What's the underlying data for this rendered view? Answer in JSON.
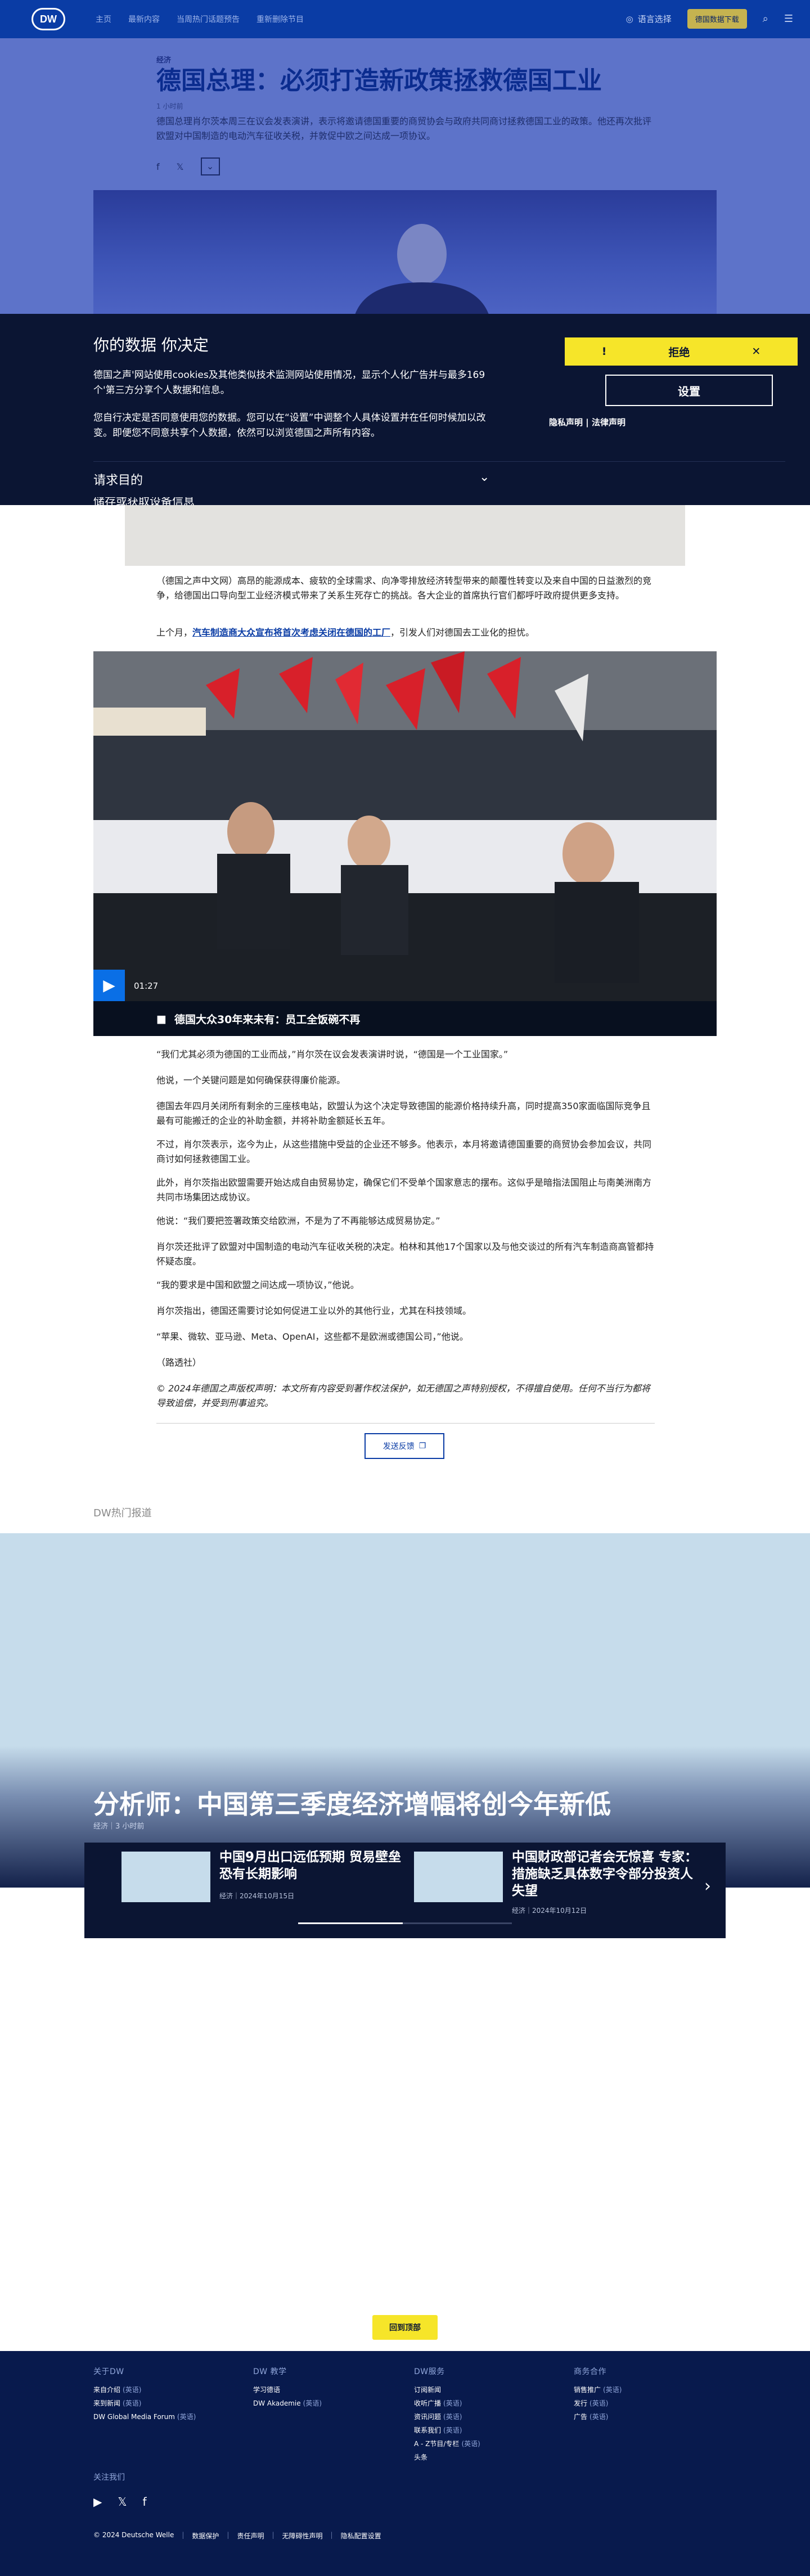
{
  "header": {
    "logo": "DW",
    "nav": [
      "主页",
      "最新内容",
      "当周热门话题预告",
      "重新删除节目"
    ],
    "lang_link": "语言选择",
    "app_button": "德国数据下载",
    "icon_search": "search-icon",
    "icon_menu": "menu-icon"
  },
  "article": {
    "kicker": "经济",
    "title": "德国总理：必须打造新政策拯救德国工业",
    "meta": "1 小时前",
    "teaser": "德国总理肖尔茨本周三在议会发表演讲，表示将邀请德国重要的商贸协会与政府共同商讨拯救德国工业的政策。他还再次批评欧盟对中国制造的电动汽车征收关税，并敦促中欧之间达成一项协议。",
    "p1": "（德国之声中文网）高昂的能源成本、疲软的全球需求、向净零排放经济转型带来的颠覆性转变以及来自中国的日益激烈的竞争，给德国出口导向型工业经济模式带来了关系生死存亡的挑战。各大企业的首席执行官们都呼吁政府提供更多支持。",
    "p2_pre": "上个月，",
    "p2_link": "汽车制造商大众宣布将首次考虑关闭在德国的工厂",
    "p2_post": "，引发人们对德国去工业化的担忧。",
    "video_duration": "01:27",
    "video_caption": "德国大众30年来未有：员工全饭碗不再",
    "paragraphs": [
      "“我们尤其必须为德国的工业而战，”肖尔茨在议会发表演讲时说，“德国是一个工业国家。”",
      "他说，一个关键问题是如何确保获得廉价能源。",
      "德国去年四月关闭所有剩余的三座核电站，欧盟认为这个决定导致德国的能源价格持续升高，同时提高350家面临国际竞争且最有可能搬迁的企业的补助金额，并将补助金额延长五年。",
      "不过，肖尔茨表示，迄今为止，从这些措施中受益的企业还不够多。他表示，本月将邀请德国重要的商贸协会参加会议，共同商讨如何拯救德国工业。",
      "此外，肖尔茨指出欧盟需要开始达成自由贸易协定，确保它们不受单个国家意志的摆布。这似乎是暗指法国阻止与南美洲南方共同市场集团达成协议。",
      "他说：“我们要把签署政策交给欧洲，不是为了不再能够达成贸易协定。”",
      "肖尔茨还批评了欧盟对中国制造的电动汽车征收关税的决定。柏林和其他17个国家以及与他交谈过的所有汽车制造商高管都持怀疑态度。",
      "“我的要求是中国和欧盟之间达成一项协议，”他说。",
      "肖尔茨指出，德国还需要讨论如何促进工业以外的其他行业，尤其在科技领域。",
      "“苹果、微软、亚马逊、Meta、OpenAI，这些都不是欧洲或德国公司，”他说。",
      "（路透社）"
    ],
    "copyright": "© 2024年德国之声版权声明：本文所有内容受到著作权法保护，如无德国之声特别授权，不得擅自使用。任何不当行为都将导致追偿，并受到刑事追究。",
    "feedback": "发送反馈"
  },
  "cookie": {
    "title": "你的数据 你决定",
    "p1": "德国之声'网站使用cookies及其他类似技术监测网站使用情况，显示个人化广告并与最多169 个'第三方分享个人数据和信息。",
    "p2": "您自行决定是否同意使用您的数据。您可以在“设置”中调整个人具体设置并在任何时候加以改变。即便您不同意共享个人数据，依然可以浏览德国之声所有内容。",
    "reject": "拒绝",
    "settings": "设置",
    "privacy": "隐私声明",
    "legal": "法律声明",
    "purposes": "请求目的",
    "cut_text": "储存或获取设备信息"
  },
  "popular": {
    "heading": "DW热门报道",
    "hero_title": "分析师：中国第三季度经济增幅将创今年新低",
    "hero_meta": "经济｜3 小时前",
    "items": [
      {
        "title": "中国9月出口远低预期 贸易壁垒恐有长期影响",
        "meta": "经济｜2024年10月15日"
      },
      {
        "title": "中国财政部记者会无惊喜 专家：措施缺乏具体数字令部分投资人失望",
        "meta": "经济｜2024年10月12日"
      }
    ]
  },
  "back_to_top": "回到顶部",
  "footer": {
    "cols": [
      {
        "heading": "关于DW",
        "items": [
          {
            "label": "来自介绍",
            "lang": "(英语)"
          },
          {
            "label": "来到新闻",
            "lang": "(英语)"
          },
          {
            "label": "DW Global Media Forum",
            "lang": "(英语)"
          }
        ]
      },
      {
        "heading": "DW 教学",
        "items": [
          {
            "label": "学习德语",
            "lang": ""
          },
          {
            "label": "DW Akademie",
            "lang": "(英语)"
          }
        ]
      },
      {
        "heading": "DW服务",
        "items": [
          {
            "label": "订阅新闻",
            "lang": ""
          },
          {
            "label": "收听广播",
            "lang": "(英语)"
          },
          {
            "label": "资讯问题",
            "lang": "(英语)"
          },
          {
            "label": "联系我们",
            "lang": "(英语)"
          },
          {
            "label": "A - Z节目/专栏",
            "lang": "(英语)"
          },
          {
            "label": "头条",
            "lang": ""
          }
        ]
      },
      {
        "heading": "商务合作",
        "items": [
          {
            "label": "销售推广",
            "lang": "(英语)"
          },
          {
            "label": "发行",
            "lang": "(英语)"
          },
          {
            "label": "广告",
            "lang": "(英语)"
          }
        ]
      }
    ],
    "follow": "关注我们",
    "bottom": [
      "© 2024 Deutsche Welle",
      "数据保护",
      "责任声明",
      "无障碍性声明",
      "隐私配置设置"
    ]
  },
  "colors": {
    "brand_blue": "#0a3ca5",
    "dark_navy": "#0b1533",
    "accent_yellow": "#f6e529"
  }
}
